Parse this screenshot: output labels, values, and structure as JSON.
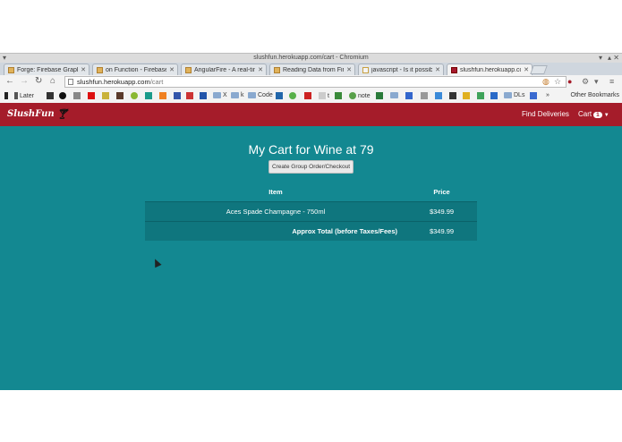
{
  "window": {
    "title": "slushfun.herokuapp.com/cart - Chromium"
  },
  "tabs": [
    {
      "label": "Forge: Firebase Graphical I",
      "favicon": "firebase"
    },
    {
      "label": "on Function - Firebase Java",
      "favicon": "firebase"
    },
    {
      "label": "AngularFire - A real-time b",
      "favicon": "firebase"
    },
    {
      "label": "Reading Data from Fireba",
      "favicon": "firebase"
    },
    {
      "label": "javascript - Is it possible to",
      "favicon": "stackoverflow"
    },
    {
      "label": "slushfun.herokuapp.com/c",
      "favicon": "slushfun",
      "active": true
    }
  ],
  "omnibox": {
    "host": "slushfun.herokuapp.com",
    "path": "/cart"
  },
  "bookmarks": {
    "items": [
      "Later",
      "X",
      "k",
      "Code",
      "t",
      "note",
      "DLs"
    ],
    "other": "Other Bookmarks"
  },
  "site": {
    "brand": "SlushFun",
    "nav": {
      "find_deliveries": "Find Deliveries",
      "cart": "Cart",
      "cart_count": "1"
    },
    "heading": "My Cart for Wine at 79",
    "checkout_button": "Create Group Order/Checkout",
    "table": {
      "headers": {
        "item": "Item",
        "price": "Price"
      },
      "rows": [
        {
          "item": "Aces Spade Champagne - 750ml",
          "price": "$349.99"
        }
      ],
      "total": {
        "label": "Approx Total (before Taxes/Fees)",
        "value": "$349.99"
      }
    }
  },
  "colors": {
    "navbar": "#a51c2a",
    "page_bg": "#138891",
    "row_bg": "#0f767e"
  }
}
